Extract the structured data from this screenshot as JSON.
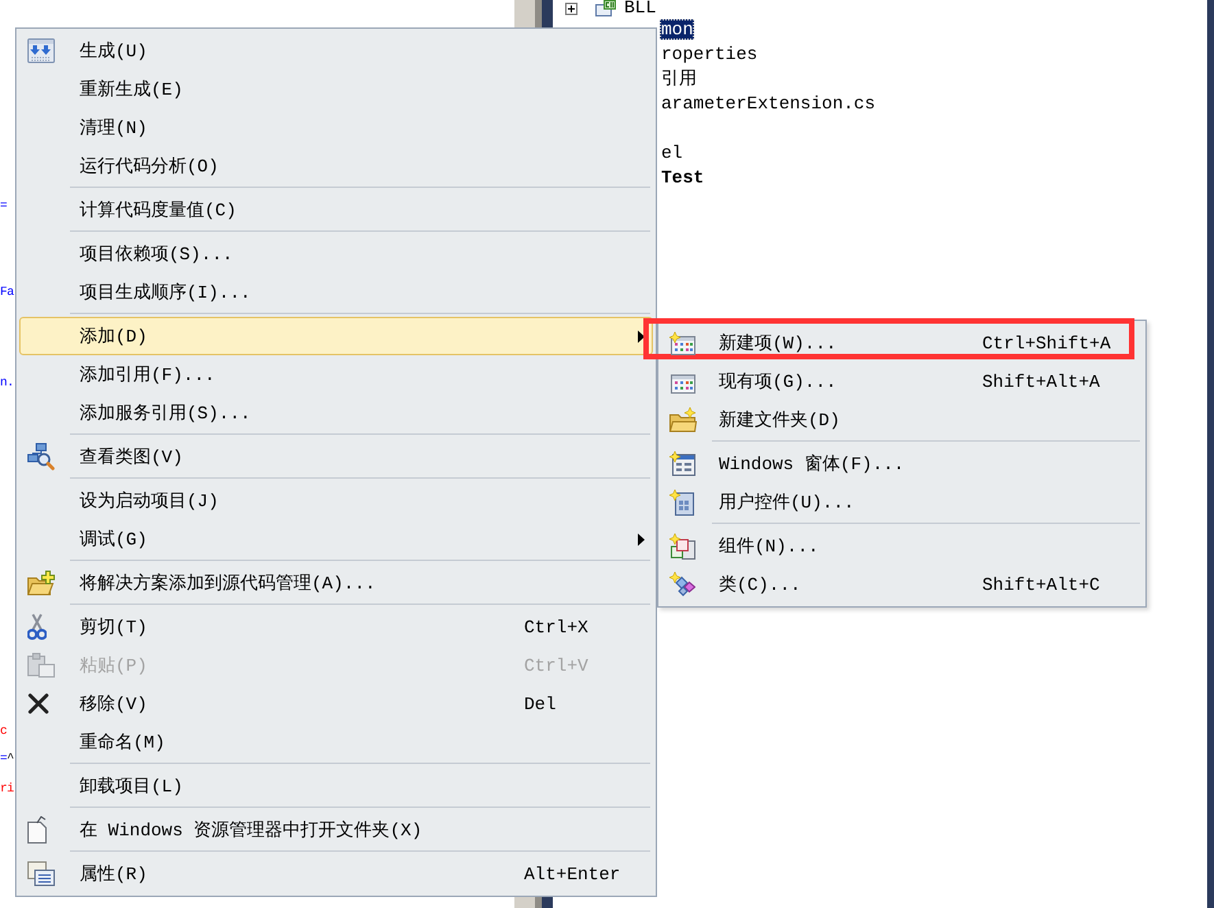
{
  "code_editor": {
    "lines": [
      {
        "parts": [
          {
            "text": "=",
            "color": "#0000ff"
          }
        ]
      },
      {
        "parts": [
          {
            "text": "Fa",
            "color": "#0000ff"
          }
        ]
      },
      {
        "parts": [
          {
            "text": "n.",
            "color": "#0000ff"
          }
        ]
      },
      {
        "parts": [
          {
            "text": "c",
            "color": "#ff0000"
          }
        ]
      },
      {
        "parts": [
          {
            "text": "=",
            "color": "#0000ff"
          },
          {
            "text": "^",
            "color": "#000000"
          }
        ]
      },
      {
        "parts": [
          {
            "text": "ri",
            "color": "#ff0000"
          }
        ]
      }
    ]
  },
  "solution_explorer": {
    "items": [
      {
        "label": "BLL",
        "expanded": false,
        "selected": false,
        "startup": false
      },
      {
        "label": "mon",
        "selected": true,
        "startup": false,
        "children": [
          {
            "label": "roperties",
            "selected": false
          },
          {
            "label": "引用",
            "selected": false
          },
          {
            "label": "arameterExtension.cs",
            "selected": false
          }
        ]
      },
      {
        "label": "el",
        "selected": false,
        "startup": false
      },
      {
        "label": "Test",
        "selected": false,
        "startup": true
      }
    ]
  },
  "context_menu": {
    "sections": [
      {
        "items": [
          {
            "label": "生成(U)",
            "selected": false,
            "disabled": false,
            "has_submenu": false
          },
          {
            "label": "重新生成(E)",
            "selected": false,
            "disabled": false,
            "has_submenu": false
          },
          {
            "label": "清理(N)",
            "selected": false,
            "disabled": false,
            "has_submenu": false
          },
          {
            "label": "运行代码分析(O)",
            "selected": false,
            "disabled": false,
            "has_submenu": false
          }
        ]
      },
      {
        "items": [
          {
            "label": "计算代码度量值(C)",
            "selected": false,
            "disabled": false,
            "has_submenu": false
          }
        ]
      },
      {
        "items": [
          {
            "label": "项目依赖项(S)...",
            "selected": false,
            "disabled": false,
            "has_submenu": false
          },
          {
            "label": "项目生成顺序(I)...",
            "selected": false,
            "disabled": false,
            "has_submenu": false
          }
        ]
      },
      {
        "items": [
          {
            "label": "添加(D)",
            "selected": true,
            "disabled": false,
            "has_submenu": true
          },
          {
            "label": "添加引用(F)...",
            "selected": false,
            "disabled": false,
            "has_submenu": false
          },
          {
            "label": "添加服务引用(S)...",
            "selected": false,
            "disabled": false,
            "has_submenu": false
          }
        ]
      },
      {
        "items": [
          {
            "label": "查看类图(V)",
            "selected": false,
            "disabled": false,
            "has_submenu": false
          }
        ]
      },
      {
        "items": [
          {
            "label": "设为启动项目(J)",
            "selected": false,
            "disabled": false,
            "has_submenu": false
          },
          {
            "label": "调试(G)",
            "selected": false,
            "disabled": false,
            "has_submenu": true
          }
        ]
      },
      {
        "items": [
          {
            "label": "将解决方案添加到源代码管理(A)...",
            "selected": false,
            "disabled": false,
            "has_submenu": false
          }
        ]
      },
      {
        "items": [
          {
            "label": "剪切(T)",
            "shortcut": "Ctrl+X",
            "selected": false,
            "disabled": false,
            "has_submenu": false
          },
          {
            "label": "粘贴(P)",
            "shortcut": "Ctrl+V",
            "selected": false,
            "disabled": true,
            "has_submenu": false
          },
          {
            "label": "移除(V)",
            "shortcut": "Del",
            "selected": false,
            "disabled": false,
            "has_submenu": false
          },
          {
            "label": "重命名(M)",
            "selected": false,
            "disabled": false,
            "has_submenu": false
          }
        ]
      },
      {
        "items": [
          {
            "label": "卸载项目(L)",
            "selected": false,
            "disabled": false,
            "has_submenu": false
          }
        ]
      },
      {
        "items": [
          {
            "label": "在 Windows 资源管理器中打开文件夹(X)",
            "selected": false,
            "disabled": false,
            "has_submenu": false
          }
        ]
      },
      {
        "items": [
          {
            "label": "属性(R)",
            "shortcut": "Alt+Enter",
            "selected": false,
            "disabled": false,
            "has_submenu": false
          }
        ]
      }
    ]
  },
  "submenu": {
    "sections": [
      {
        "items": [
          {
            "label": "新建项(W)...",
            "shortcut": "Ctrl+Shift+A",
            "selected": false,
            "annotated": true
          },
          {
            "label": "现有项(G)...",
            "shortcut": "Shift+Alt+A",
            "selected": false,
            "annotated": false
          },
          {
            "label": "新建文件夹(D)",
            "selected": false,
            "annotated": false
          }
        ]
      },
      {
        "items": [
          {
            "label": "Windows 窗体(F)...",
            "selected": false,
            "annotated": false
          },
          {
            "label": "用户控件(U)...",
            "selected": false,
            "annotated": false
          }
        ]
      },
      {
        "items": [
          {
            "label": "组件(N)...",
            "selected": false,
            "annotated": false
          },
          {
            "label": "类(C)...",
            "shortcut": "Shift+Alt+C",
            "selected": false,
            "annotated": false
          }
        ]
      }
    ]
  }
}
